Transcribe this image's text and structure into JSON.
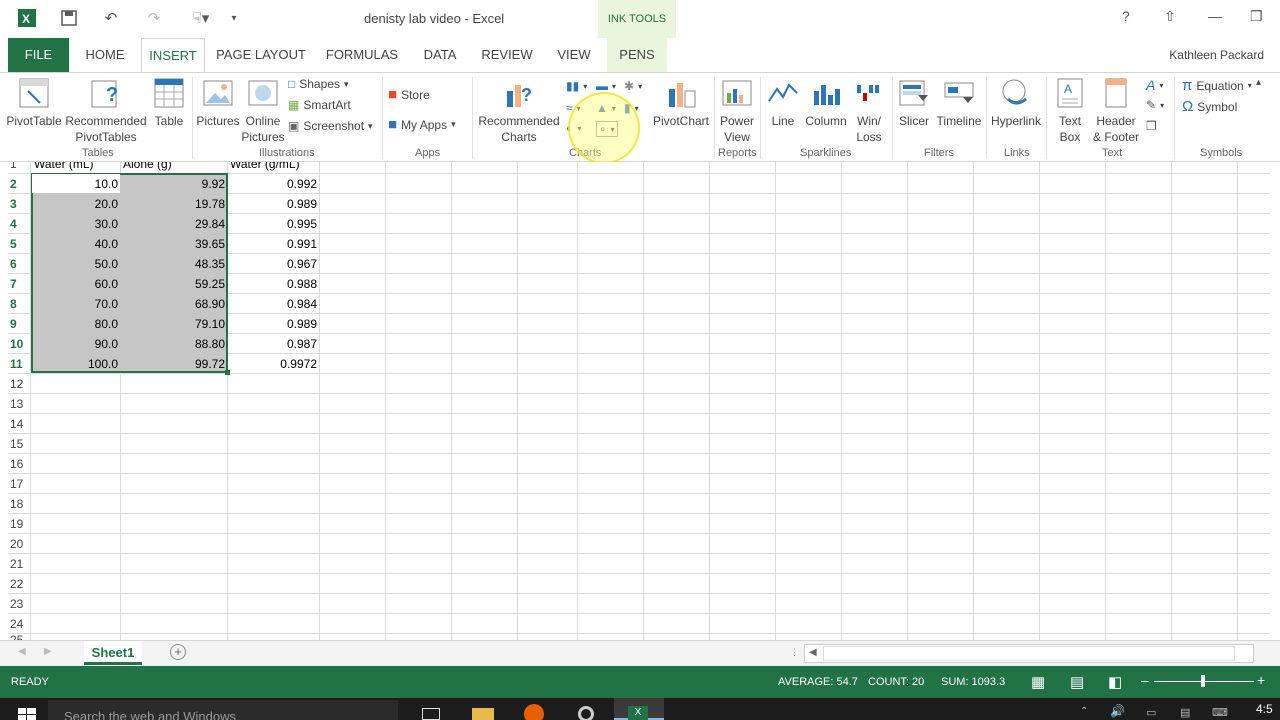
{
  "title_bar": {
    "doc_title": "denisty lab video - Excel",
    "context_tab": "INK TOOLS",
    "help": "?"
  },
  "tabs": [
    {
      "label": "FILE"
    },
    {
      "label": "HOME"
    },
    {
      "label": "INSERT"
    },
    {
      "label": "PAGE LAYOUT"
    },
    {
      "label": "FORMULAS"
    },
    {
      "label": "DATA"
    },
    {
      "label": "REVIEW"
    },
    {
      "label": "VIEW"
    },
    {
      "label": "PENS"
    }
  ],
  "user_name": "Kathleen Packard",
  "ribbon": {
    "pivot_table": "PivotTable",
    "rec_pivot_1": "Recommended",
    "rec_pivot_2": "PivotTables",
    "table": "Table",
    "tables_group": "Tables",
    "pictures": "Pictures",
    "online_1": "Online",
    "online_2": "Pictures",
    "shapes": "Shapes",
    "smartart": "SmartArt",
    "screenshot": "Screenshot",
    "illustrations_group": "Illustrations",
    "store": "Store",
    "my_apps": "My Apps",
    "apps_group": "Apps",
    "rec_charts_1": "Recommended",
    "rec_charts_2": "Charts",
    "charts_group": "Charts",
    "pivot_chart": "PivotChart",
    "power_1": "Power",
    "power_2": "View",
    "reports_group": "Reports",
    "line": "Line",
    "column": "Column",
    "winloss_1": "Win/",
    "winloss_2": "Loss",
    "sparklines_group": "Sparklines",
    "slicer": "Slicer",
    "timeline": "Timeline",
    "filters_group": "Filters",
    "hyperlink": "Hyperlink",
    "links_group": "Links",
    "textbox_1": "Text",
    "textbox_2": "Box",
    "header_1": "Header",
    "header_2": "& Footer",
    "text_group": "Text",
    "equation": "Equation",
    "symbol": "Symbol",
    "symbols_group": "Symbols"
  },
  "sheet": {
    "header_row_label": "1",
    "headers": [
      "Water (mL)",
      "Alone (g)",
      "Water (g/mL)"
    ],
    "rows": [
      {
        "row": "2",
        "a": "10.0",
        "b": "9.92",
        "c": "0.992"
      },
      {
        "row": "3",
        "a": "20.0",
        "b": "19.78",
        "c": "0.989"
      },
      {
        "row": "4",
        "a": "30.0",
        "b": "29.84",
        "c": "0.995"
      },
      {
        "row": "5",
        "a": "40.0",
        "b": "39.65",
        "c": "0.991"
      },
      {
        "row": "6",
        "a": "50.0",
        "b": "48.35",
        "c": "0.967"
      },
      {
        "row": "7",
        "a": "60.0",
        "b": "59.25",
        "c": "0.988"
      },
      {
        "row": "8",
        "a": "70.0",
        "b": "68.90",
        "c": "0.984"
      },
      {
        "row": "9",
        "a": "80.0",
        "b": "79.10",
        "c": "0.989"
      },
      {
        "row": "10",
        "a": "90.0",
        "b": "88.80",
        "c": "0.987"
      },
      {
        "row": "11",
        "a": "100.0",
        "b": "99.72",
        "c": "0.9972"
      }
    ],
    "empty_rows": [
      "12",
      "13",
      "14",
      "15",
      "16",
      "17",
      "18",
      "19",
      "20",
      "21",
      "22",
      "23",
      "24",
      "25"
    ]
  },
  "sheet_tab": "Sheet1",
  "status": {
    "ready": "READY",
    "average": "AVERAGE: 54.7",
    "count": "COUNT: 20",
    "sum": "SUM: 1093.3"
  },
  "taskbar": {
    "search": "Search the web and Windows",
    "clock": "4:5"
  },
  "colors": {
    "excel_green": "#217346",
    "selection": "#c6c6c6",
    "ink_highlight": "#ffff78"
  }
}
